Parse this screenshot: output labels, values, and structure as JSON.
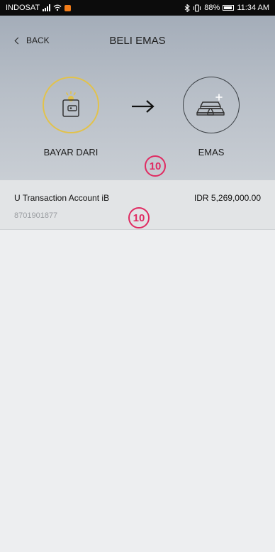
{
  "status_bar": {
    "carrier": "INDOSAT",
    "battery": "88%",
    "time": "11:34 AM"
  },
  "nav": {
    "back_label": "BACK",
    "title": "BELI EMAS"
  },
  "transfer": {
    "source_label": "BAYAR DARI",
    "destination_label": "EMAS",
    "source_icon": "wallet-icon",
    "destination_icon": "gold-bars-icon",
    "accent_color": "#e2c24a"
  },
  "annotations": [
    "10",
    "10"
  ],
  "account": {
    "name": "U Transaction Account iB",
    "number": "8701901877",
    "balance": "IDR 5,269,000.00"
  }
}
